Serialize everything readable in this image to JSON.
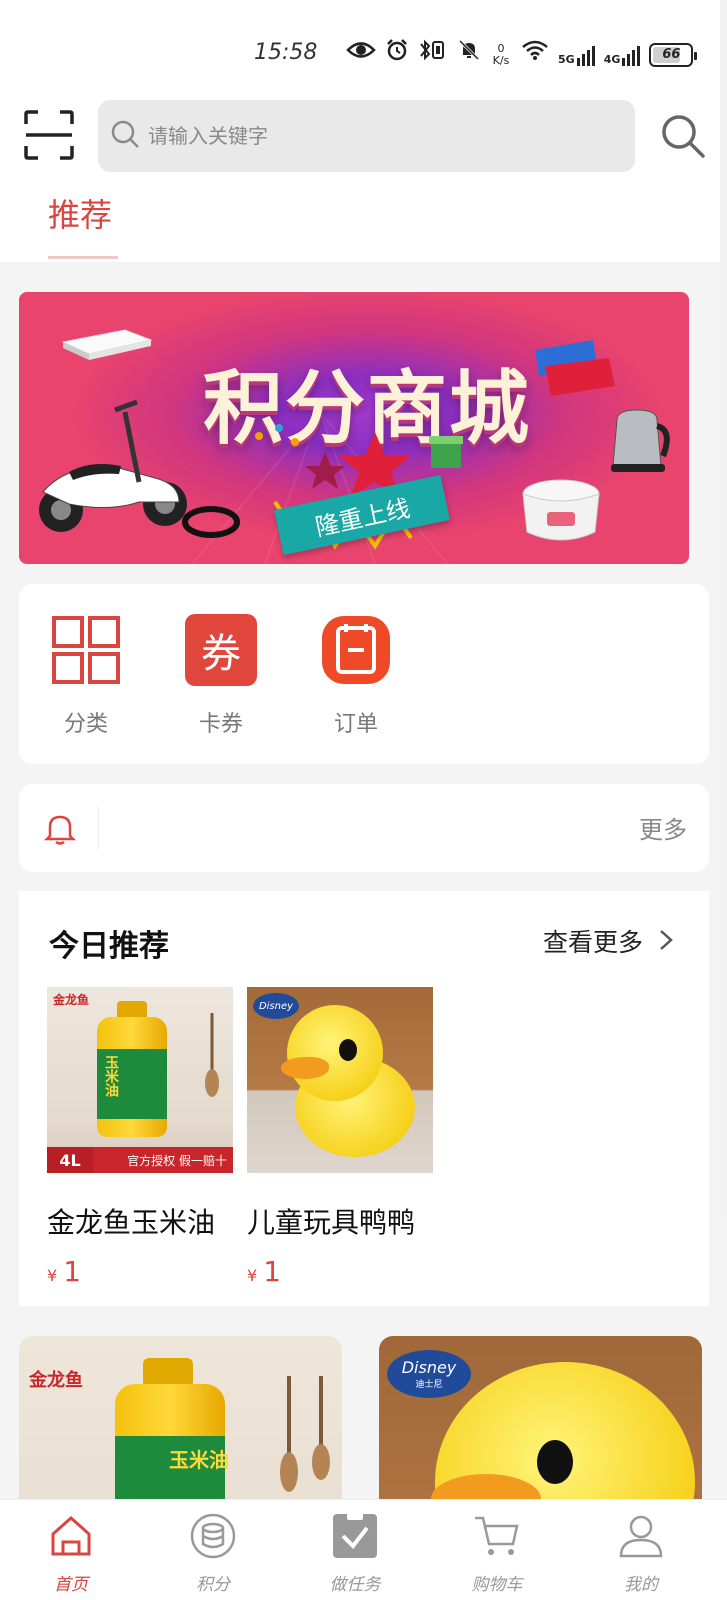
{
  "status_bar": {
    "time": "15:58",
    "speed_value": "0",
    "speed_unit": "K/s",
    "network_5g": "5G",
    "network_4g": "4G",
    "battery": "66",
    "icons": [
      "eye-icon",
      "alarm-icon",
      "bluetooth-icon",
      "vibrate-icon",
      "mute-icon",
      "wifi-icon",
      "signal-5g-icon",
      "signal-4g-icon",
      "battery-icon"
    ]
  },
  "header": {
    "search_placeholder": "请输入关键字",
    "scan_icon": "scan-icon",
    "search_icon": "search-icon"
  },
  "tabs": [
    {
      "label": "推荐",
      "active": true
    }
  ],
  "banner": {
    "title": "积分商城",
    "ribbon": "隆重上线"
  },
  "quick_entries": [
    {
      "label": "分类",
      "icon": "category-grid-icon"
    },
    {
      "label": "卡券",
      "icon": "coupon-icon",
      "glyph": "券"
    },
    {
      "label": "订单",
      "icon": "order-icon"
    }
  ],
  "notice": {
    "more": "更多",
    "icon": "bell-icon"
  },
  "today_recommend": {
    "title": "今日推荐",
    "more": "查看更多",
    "currency": "¥",
    "products": [
      {
        "name": "金龙鱼玉米油",
        "price": "1",
        "image_text": {
          "brand": "金龙鱼",
          "label": "玉米油",
          "volume": "4L",
          "strip": "官方授权 假一赔十"
        }
      },
      {
        "name": "儿童玩具鸭鸭",
        "price": "1",
        "image_text": {
          "brand": "Disney"
        }
      }
    ]
  },
  "feed_cards": [
    {
      "brand": "金龙鱼",
      "label": "玉米油"
    },
    {
      "brand": "Disney",
      "sub": "迪士尼"
    }
  ],
  "bottom_nav": [
    {
      "label": "首页",
      "icon": "home-icon",
      "active": true
    },
    {
      "label": "积分",
      "icon": "points-icon",
      "active": false
    },
    {
      "label": "做任务",
      "icon": "task-icon",
      "active": false
    },
    {
      "label": "购物车",
      "icon": "cart-icon",
      "active": false
    },
    {
      "label": "我的",
      "icon": "profile-icon",
      "active": false
    }
  ],
  "colors": {
    "accent": "#d9453f",
    "banner": "#e8446d",
    "page_bg": "#f4f4f4"
  }
}
